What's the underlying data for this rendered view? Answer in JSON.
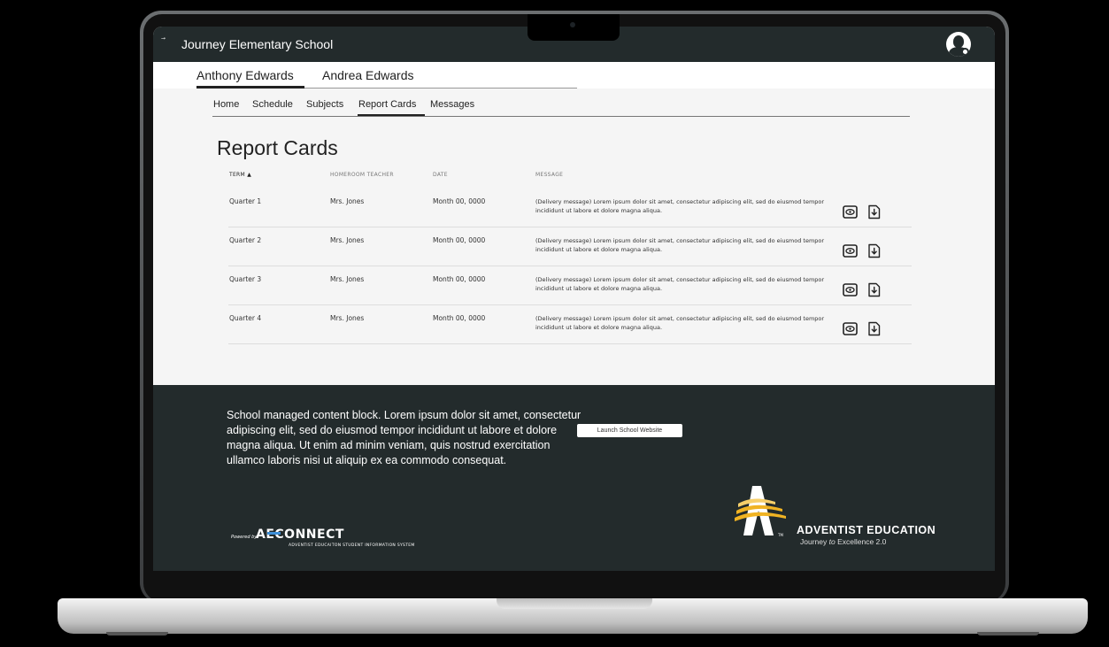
{
  "app": {
    "school_name": "Journey Elementary School"
  },
  "students": [
    {
      "name": "Anthony Edwards"
    },
    {
      "name": "Andrea Edwards"
    }
  ],
  "nav": {
    "items": [
      "Home",
      "Schedule",
      "Subjects",
      "Report Cards",
      "Messages"
    ],
    "active": "Report Cards"
  },
  "page": {
    "title": "Report Cards"
  },
  "table": {
    "headers": {
      "term": "TERM ▲",
      "teacher": "HOMEROOM TEACHER",
      "date": "DATE",
      "message": "MESSAGE"
    },
    "rows": [
      {
        "term": "Quarter 1",
        "teacher": "Mrs. Jones",
        "date": "Month 00, 0000",
        "message": "(Delivery message) Lorem ipsum dolor sit amet, consectetur adipiscing elit, sed do eiusmod tempor incididunt ut labore et dolore magna aliqua."
      },
      {
        "term": "Quarter 2",
        "teacher": "Mrs. Jones",
        "date": "Month 00, 0000",
        "message": "(Delivery message) Lorem ipsum dolor sit amet, consectetur adipiscing elit, sed do eiusmod tempor incididunt ut labore et dolore magna aliqua."
      },
      {
        "term": "Quarter 3",
        "teacher": "Mrs. Jones",
        "date": "Month 00, 0000",
        "message": "(Delivery message) Lorem ipsum dolor sit amet, consectetur adipiscing elit, sed do eiusmod tempor incididunt ut labore et dolore magna aliqua."
      },
      {
        "term": "Quarter 4",
        "teacher": "Mrs. Jones",
        "date": "Month 00, 0000",
        "message": "(Delivery message) Lorem ipsum dolor sit amet, consectetur adipiscing elit, sed do eiusmod tempor incididunt ut labore et dolore magna aliqua."
      }
    ],
    "row_icons": [
      "eye-icon",
      "download-icon"
    ]
  },
  "footer": {
    "content": "School managed content block. Lorem ipsum dolor sit amet, consectetur adipiscing elit, sed do eiusmod tempor incididunt ut labore et dolore magna aliqua. Ut enim ad minim veniam, quis nostrud exercitation ullamco laboris nisi ut aliquip ex ea commodo consequat.",
    "launch_button": "Launch School Website",
    "powered_by": "Powered by",
    "aeconnect": "AECONNECT",
    "aeconnect_sub": "ADVENTIST EDUCAITON STUDENT INFORMATION SYSTEM",
    "adventist_title": "ADVENTIST EDUCATION",
    "adventist_tag_1": "Journey ",
    "adventist_tag_2": "to",
    "adventist_tag_3": " Excellence 2.0",
    "tm": "TM"
  },
  "colors": {
    "dark": "#232b2c",
    "page_bg": "#f5f5f5",
    "accent_gold": "#f0b323",
    "accent_blue": "#3d8fd8"
  }
}
